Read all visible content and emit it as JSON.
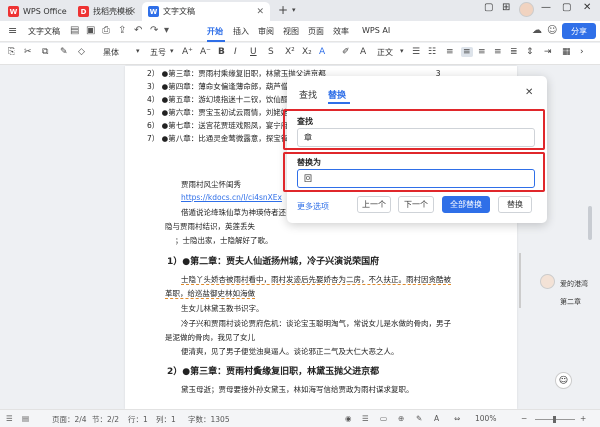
{
  "titlebar": {
    "tabs": [
      {
        "label": "WPS Office"
      },
      {
        "label": "找稻壳模板"
      },
      {
        "label": "文字文稿"
      }
    ],
    "new_tab": "+",
    "close": "✕"
  },
  "menubar": {
    "doc_name": "文字文稿",
    "items": [
      "开始",
      "插入",
      "审阅",
      "视图",
      "页面",
      "效率",
      "WPS AI"
    ],
    "active": "开始",
    "share": "分享"
  },
  "toolbar": {
    "font": "黑体",
    "size": "五号",
    "style": "正文"
  },
  "document": {
    "toc": [
      {
        "num": "2）",
        "text": "●第三章：贾雨村乘缘复旧职，林黛玉抛父进京都",
        "page": "3"
      },
      {
        "num": "3）",
        "text": "●第四章：薄命女偏逢薄命郎，葫芦僧"
      },
      {
        "num": "4）",
        "text": "●第五章：游幻境指迷十二钗，饮仙醪"
      },
      {
        "num": "5）",
        "text": "●第六章：贾宝玉初试云雨情，刘姥姥"
      },
      {
        "num": "6）",
        "text": "●第七章：送宫花贾琏戏熙凤，宴宁府"
      },
      {
        "num": "7）",
        "text": "●第八章：比通灵金莺微露意，探宝钗"
      }
    ],
    "body": [
      "贾雨村风尘怀闺秀",
      "https://kdocs.cn/l/ci4snXEx",
      "借遁说论绛珠仙草为神瑛侍者还",
      "隐与贾雨村结识，英莲丢失",
      "；士隐出家，士隐解好了歌。"
    ],
    "chapter2_heading": "1）●第二章：贾夫人仙逝扬州城，冷子兴演说荣国府",
    "chapter2_body": [
      "士隐丫头娇杏被雨村看中，雨村发迹后先娶娇杏为二房，不久扶正。雨村因贪酷被",
      "革职，给巡盐御史林如海做",
      "生女儿林黛玉教书识字。",
      "冷子兴和贾雨村谈论贾府危机：谈论宝玉聪明淘气，常说女儿是水做的骨肉，男子",
      "是泥做的骨肉，我见了女儿",
      "便清爽，见了男子便觉浊臭逼人。谈论邪正二气及大仁大恶之人。"
    ],
    "chapter3_heading": "2）●第三章：贾雨村夤缘复旧职，林黛玉抛父进京都",
    "chapter3_body": [
      "黛玉母逝；贾母要接外孙女黛玉，林如海写信给贾政为雨村谋求复职。"
    ]
  },
  "dialog": {
    "tabs": [
      "查找",
      "替换"
    ],
    "active_tab": "替换",
    "find_label": "查找",
    "find_value": "章",
    "replace_label": "替换为",
    "replace_value": "回",
    "more_options": "更多选项",
    "buttons": {
      "prev": "上一个",
      "next": "下一个",
      "replace_all": "全部替换",
      "replace": "替换"
    }
  },
  "side_panel": {
    "user_name": "爱的港湾",
    "chapter": "第二章"
  },
  "statusbar": {
    "page": "页面：2/4",
    "section": "节：2/2",
    "row": "行：1",
    "col": "列：1",
    "words": "字数：1305",
    "zoom": "100%"
  },
  "colors": {
    "accent": "#2f6fe8",
    "highlight_box": "#e0272b"
  }
}
